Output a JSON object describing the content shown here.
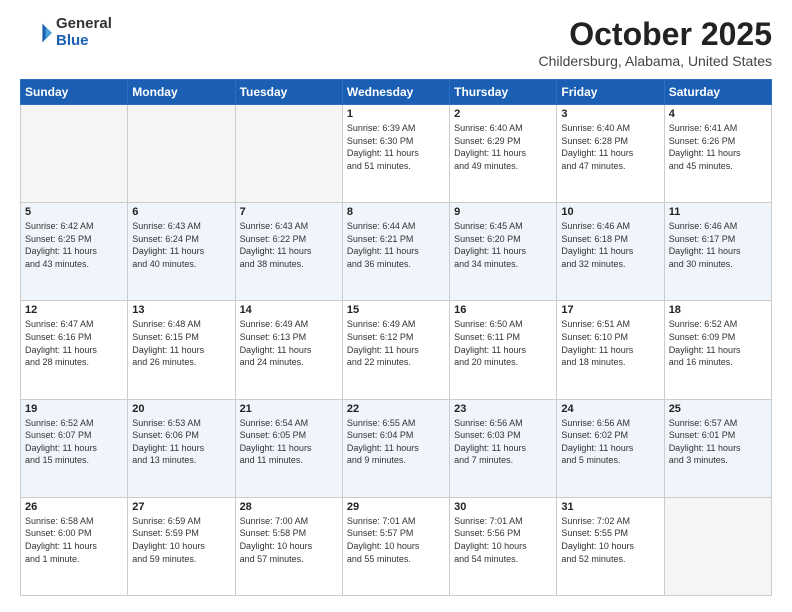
{
  "header": {
    "logo_general": "General",
    "logo_blue": "Blue",
    "title": "October 2025",
    "location": "Childersburg, Alabama, United States"
  },
  "weekdays": [
    "Sunday",
    "Monday",
    "Tuesday",
    "Wednesday",
    "Thursday",
    "Friday",
    "Saturday"
  ],
  "weeks": [
    [
      {
        "day": "",
        "info": ""
      },
      {
        "day": "",
        "info": ""
      },
      {
        "day": "",
        "info": ""
      },
      {
        "day": "1",
        "info": "Sunrise: 6:39 AM\nSunset: 6:30 PM\nDaylight: 11 hours\nand 51 minutes."
      },
      {
        "day": "2",
        "info": "Sunrise: 6:40 AM\nSunset: 6:29 PM\nDaylight: 11 hours\nand 49 minutes."
      },
      {
        "day": "3",
        "info": "Sunrise: 6:40 AM\nSunset: 6:28 PM\nDaylight: 11 hours\nand 47 minutes."
      },
      {
        "day": "4",
        "info": "Sunrise: 6:41 AM\nSunset: 6:26 PM\nDaylight: 11 hours\nand 45 minutes."
      }
    ],
    [
      {
        "day": "5",
        "info": "Sunrise: 6:42 AM\nSunset: 6:25 PM\nDaylight: 11 hours\nand 43 minutes."
      },
      {
        "day": "6",
        "info": "Sunrise: 6:43 AM\nSunset: 6:24 PM\nDaylight: 11 hours\nand 40 minutes."
      },
      {
        "day": "7",
        "info": "Sunrise: 6:43 AM\nSunset: 6:22 PM\nDaylight: 11 hours\nand 38 minutes."
      },
      {
        "day": "8",
        "info": "Sunrise: 6:44 AM\nSunset: 6:21 PM\nDaylight: 11 hours\nand 36 minutes."
      },
      {
        "day": "9",
        "info": "Sunrise: 6:45 AM\nSunset: 6:20 PM\nDaylight: 11 hours\nand 34 minutes."
      },
      {
        "day": "10",
        "info": "Sunrise: 6:46 AM\nSunset: 6:18 PM\nDaylight: 11 hours\nand 32 minutes."
      },
      {
        "day": "11",
        "info": "Sunrise: 6:46 AM\nSunset: 6:17 PM\nDaylight: 11 hours\nand 30 minutes."
      }
    ],
    [
      {
        "day": "12",
        "info": "Sunrise: 6:47 AM\nSunset: 6:16 PM\nDaylight: 11 hours\nand 28 minutes."
      },
      {
        "day": "13",
        "info": "Sunrise: 6:48 AM\nSunset: 6:15 PM\nDaylight: 11 hours\nand 26 minutes."
      },
      {
        "day": "14",
        "info": "Sunrise: 6:49 AM\nSunset: 6:13 PM\nDaylight: 11 hours\nand 24 minutes."
      },
      {
        "day": "15",
        "info": "Sunrise: 6:49 AM\nSunset: 6:12 PM\nDaylight: 11 hours\nand 22 minutes."
      },
      {
        "day": "16",
        "info": "Sunrise: 6:50 AM\nSunset: 6:11 PM\nDaylight: 11 hours\nand 20 minutes."
      },
      {
        "day": "17",
        "info": "Sunrise: 6:51 AM\nSunset: 6:10 PM\nDaylight: 11 hours\nand 18 minutes."
      },
      {
        "day": "18",
        "info": "Sunrise: 6:52 AM\nSunset: 6:09 PM\nDaylight: 11 hours\nand 16 minutes."
      }
    ],
    [
      {
        "day": "19",
        "info": "Sunrise: 6:52 AM\nSunset: 6:07 PM\nDaylight: 11 hours\nand 15 minutes."
      },
      {
        "day": "20",
        "info": "Sunrise: 6:53 AM\nSunset: 6:06 PM\nDaylight: 11 hours\nand 13 minutes."
      },
      {
        "day": "21",
        "info": "Sunrise: 6:54 AM\nSunset: 6:05 PM\nDaylight: 11 hours\nand 11 minutes."
      },
      {
        "day": "22",
        "info": "Sunrise: 6:55 AM\nSunset: 6:04 PM\nDaylight: 11 hours\nand 9 minutes."
      },
      {
        "day": "23",
        "info": "Sunrise: 6:56 AM\nSunset: 6:03 PM\nDaylight: 11 hours\nand 7 minutes."
      },
      {
        "day": "24",
        "info": "Sunrise: 6:56 AM\nSunset: 6:02 PM\nDaylight: 11 hours\nand 5 minutes."
      },
      {
        "day": "25",
        "info": "Sunrise: 6:57 AM\nSunset: 6:01 PM\nDaylight: 11 hours\nand 3 minutes."
      }
    ],
    [
      {
        "day": "26",
        "info": "Sunrise: 6:58 AM\nSunset: 6:00 PM\nDaylight: 11 hours\nand 1 minute."
      },
      {
        "day": "27",
        "info": "Sunrise: 6:59 AM\nSunset: 5:59 PM\nDaylight: 10 hours\nand 59 minutes."
      },
      {
        "day": "28",
        "info": "Sunrise: 7:00 AM\nSunset: 5:58 PM\nDaylight: 10 hours\nand 57 minutes."
      },
      {
        "day": "29",
        "info": "Sunrise: 7:01 AM\nSunset: 5:57 PM\nDaylight: 10 hours\nand 55 minutes."
      },
      {
        "day": "30",
        "info": "Sunrise: 7:01 AM\nSunset: 5:56 PM\nDaylight: 10 hours\nand 54 minutes."
      },
      {
        "day": "31",
        "info": "Sunrise: 7:02 AM\nSunset: 5:55 PM\nDaylight: 10 hours\nand 52 minutes."
      },
      {
        "day": "",
        "info": ""
      }
    ]
  ]
}
